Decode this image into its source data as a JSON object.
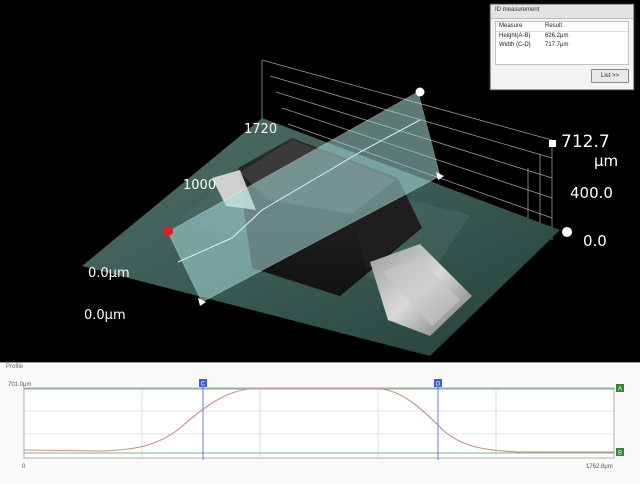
{
  "viewer": {
    "z_max_value": "712.7",
    "z_unit": "μm",
    "z_mid": "400.0",
    "z_min": "0.0",
    "y_max": "1720",
    "y_mid": "1000",
    "y_zero": "0.0μm",
    "x_zero": "0.0μm"
  },
  "measurement": {
    "title": "ID measurement",
    "col_measure": "Measure",
    "col_result": "Result",
    "rows": [
      {
        "measure": "Height(A-B)",
        "result": "626.2μm"
      },
      {
        "measure": "Width (C-D)",
        "result": "717.7μm"
      }
    ],
    "list_button": "List >>"
  },
  "profile": {
    "title": "Profile",
    "y_top_label": "701.0μm",
    "x_min_label": "0",
    "x_max_label": "1762.8μm",
    "marker_c": "C",
    "marker_d": "D",
    "marker_a": "A",
    "marker_b": "B"
  },
  "colors": {
    "profile_curve": "#c98b8b",
    "marker_blue": "#3d5fd0",
    "marker_green": "#2f8a2f",
    "cut_plane": "#a9dcd8"
  }
}
